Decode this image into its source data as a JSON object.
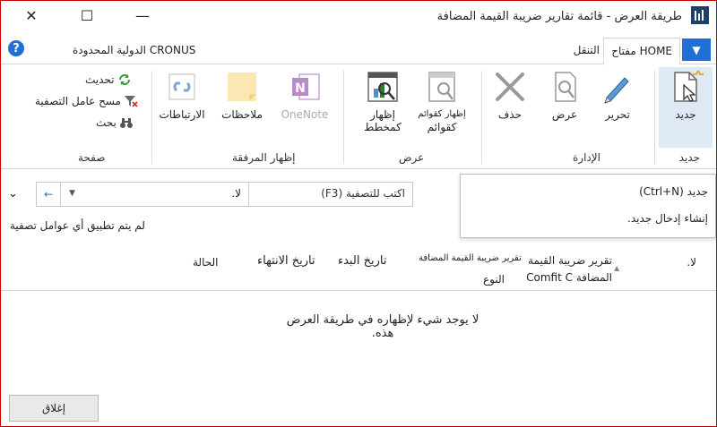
{
  "window": {
    "title": "طريقة العرض - قائمة تقارير ضريبة القيمة المضافة",
    "minimize_glyph": "—",
    "maximize_glyph": "☐",
    "close_glyph": "✕"
  },
  "tabs": {
    "home": "مفتاح HOME",
    "navigate": "التنقل",
    "company": "CRONUS الدولية المحدودة"
  },
  "ribbon": {
    "new": {
      "new": "جديد",
      "group_label": "جديد"
    },
    "manage": {
      "edit": "تحرير",
      "view": "عرض",
      "delete": "حذف",
      "group_label": "الإدارة"
    },
    "view": {
      "show_as_list": "إظهار كقوائم",
      "show_as_list2": "كقوائم",
      "show_as_chart": "إظهار",
      "show_as_chart2": "كمخطط",
      "group_label": "عرض"
    },
    "attach": {
      "onenote": "OneNote",
      "notes": "ملاحظات",
      "links": "الارتباطات",
      "group_label": "إظهار المرفقة"
    },
    "page": {
      "refresh": "تحديث",
      "clear_filter": "مسح عامل التصفية",
      "find": "بحث",
      "group_label": "صفحة"
    }
  },
  "filter": {
    "field_value": "لا.",
    "placeholder": "اكتب للتصفية (F3)",
    "status": "لم يتم تطبيق أي عوامل تصفية"
  },
  "popup": {
    "title": "جديد (Ctrl+N)",
    "description": "إنشاء إدخال جديد."
  },
  "table": {
    "col_no": "لا.",
    "col_report_line1": "تقرير ضريبة القيمة",
    "col_report_line2": "المضافة Comfit C",
    "col_report_config_line1": "تقرير ضريبة القيمة المضافة",
    "col_report_config_line2": "النوع",
    "col_start_date": "تاريخ البدء",
    "col_end_date": "تاريخ الانتهاء",
    "col_status": "الحالة",
    "empty_message": "لا يوجد شيء لإظهاره في طريقة العرض هذه."
  },
  "footer": {
    "close": "إغلاق"
  },
  "colors": {
    "accent": "#1f6fd6",
    "border": "#c00000",
    "onenote": "#8b3fa8"
  }
}
